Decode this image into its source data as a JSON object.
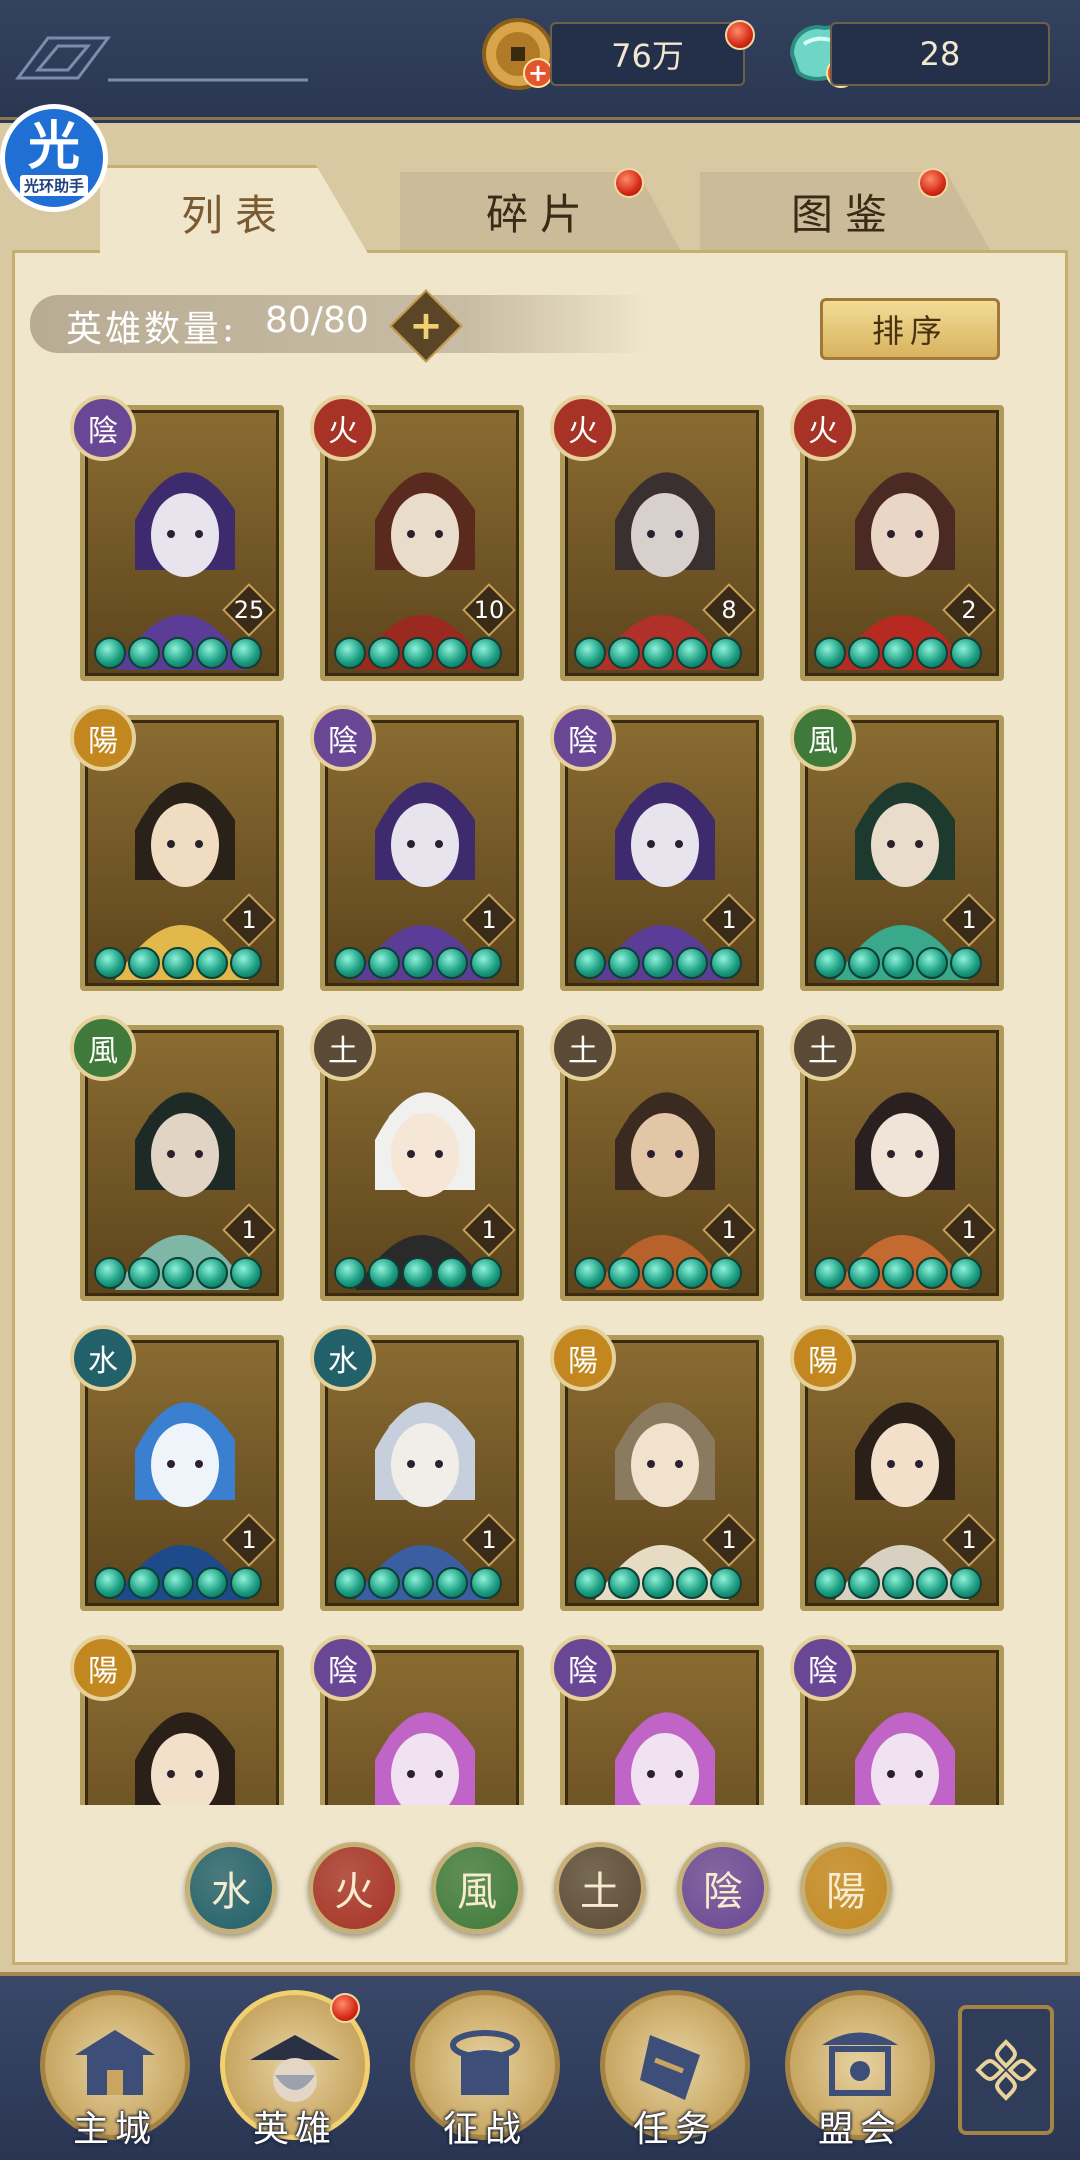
{
  "currency": {
    "coins": "76万",
    "gems": "28"
  },
  "logo": {
    "big": "光",
    "small": "光环助手"
  },
  "tabs": [
    {
      "label": "列表"
    },
    {
      "label": "碎片"
    },
    {
      "label": "图鉴"
    }
  ],
  "hero_count": {
    "label": "英雄数量:",
    "value": "80/80"
  },
  "sort_label": "排序",
  "heroes": [
    {
      "element": "陰",
      "level": "25",
      "color": "#6a4794"
    },
    {
      "element": "火",
      "level": "10",
      "color": "#a63326"
    },
    {
      "element": "火",
      "level": "8",
      "color": "#a63326"
    },
    {
      "element": "火",
      "level": "2",
      "color": "#a63326"
    },
    {
      "element": "陽",
      "level": "1",
      "color": "#c2881f"
    },
    {
      "element": "陰",
      "level": "1",
      "color": "#6a4794"
    },
    {
      "element": "陰",
      "level": "1",
      "color": "#6a4794"
    },
    {
      "element": "風",
      "level": "1",
      "color": "#3f7a3a"
    },
    {
      "element": "風",
      "level": "1",
      "color": "#3f7a3a"
    },
    {
      "element": "土",
      "level": "1",
      "color": "#5a4a36"
    },
    {
      "element": "土",
      "level": "1",
      "color": "#5a4a36"
    },
    {
      "element": "土",
      "level": "1",
      "color": "#5a4a36"
    },
    {
      "element": "水",
      "level": "1",
      "color": "#22606a"
    },
    {
      "element": "水",
      "level": "1",
      "color": "#22606a"
    },
    {
      "element": "陽",
      "level": "1",
      "color": "#c2881f"
    },
    {
      "element": "陽",
      "level": "1",
      "color": "#c2881f"
    },
    {
      "element": "陽",
      "level": "",
      "color": "#c2881f"
    },
    {
      "element": "陰",
      "level": "",
      "color": "#6a4794"
    },
    {
      "element": "陰",
      "level": "",
      "color": "#6a4794"
    },
    {
      "element": "陰",
      "level": "",
      "color": "#6a4794"
    }
  ],
  "element_filters": [
    {
      "label": "水",
      "color": "#22606a"
    },
    {
      "label": "火",
      "color": "#a63326"
    },
    {
      "label": "風",
      "color": "#3f7a3a"
    },
    {
      "label": "土",
      "color": "#5a4a36"
    },
    {
      "label": "陰",
      "color": "#6a4794"
    },
    {
      "label": "陽",
      "color": "#c2881f"
    }
  ],
  "nav": [
    {
      "label": "主城"
    },
    {
      "label": "英雄"
    },
    {
      "label": "征战"
    },
    {
      "label": "任务"
    },
    {
      "label": "盟会"
    }
  ]
}
